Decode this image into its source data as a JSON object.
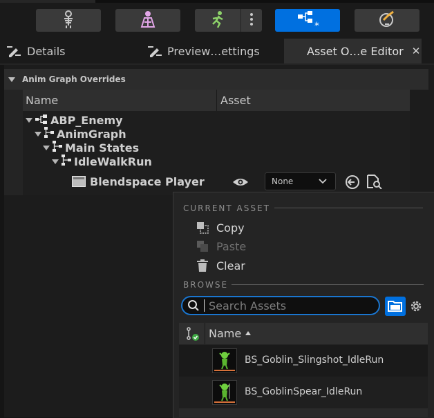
{
  "toolbar": {
    "buttons": [
      {
        "icon": "skeleton-icon"
      },
      {
        "icon": "mesh-icon"
      },
      {
        "icon": "animation-icon"
      },
      {
        "icon": "blueprint-icon",
        "active": true
      },
      {
        "icon": "physics-icon"
      }
    ],
    "more_icon": "kebab-menu-icon"
  },
  "tabs": [
    {
      "label": "Details",
      "icon": "details-icon"
    },
    {
      "label": "Preview…ettings",
      "icon": "preview-settings-icon"
    },
    {
      "label": "Asset O…e Editor",
      "active": true,
      "close": "✕"
    }
  ],
  "category": {
    "label": "Anim Graph Overrides"
  },
  "table": {
    "col_name": "Name",
    "col_asset": "Asset"
  },
  "tree": [
    {
      "label": "ABP_Enemy"
    },
    {
      "label": "AnimGraph"
    },
    {
      "label": "Main States"
    },
    {
      "label": "IdleWalkRun"
    },
    {
      "label": "Blendspace Player"
    }
  ],
  "asset_picker": {
    "value": "None"
  },
  "menu": {
    "current_asset_header": "CURRENT ASSET",
    "copy": "Copy",
    "paste": "Paste",
    "clear": "Clear",
    "browse_header": "BROWSE",
    "search_placeholder": "Search Assets",
    "name_header": "Name",
    "assets": [
      {
        "name": "BS_Goblin_Slingshot_IdleRun"
      },
      {
        "name": "BS_GoblinSpear_IdleRun"
      }
    ]
  },
  "colors": {
    "accent": "#0070e0",
    "background": "#151515"
  }
}
